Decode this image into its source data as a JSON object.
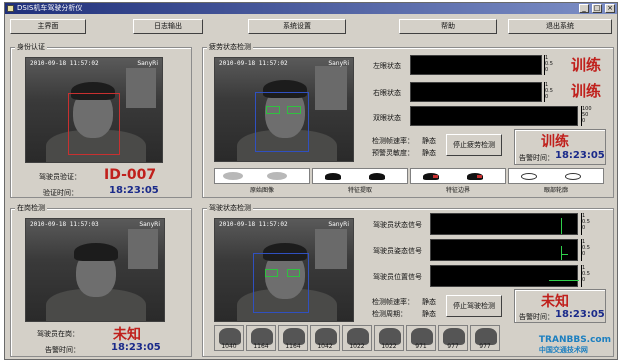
{
  "window": {
    "title": "DSIS机车驾驶分析仪",
    "controls": [
      "_",
      "□",
      "×"
    ]
  },
  "menu": [
    "主界面",
    "日志输出",
    "系统设置",
    "帮助",
    "退出系统"
  ],
  "identity": {
    "legend": "身份认证",
    "stamp": "2010-09-18 11:57:02",
    "stamp_right": "SanyRi",
    "driver_label": "驾驶员验证：",
    "driver_value": "ID-007",
    "time_label": "验证时间：",
    "time_value": "18:23:05"
  },
  "fatigue": {
    "legend": "疲劳状态检测",
    "stamp": "2010-09-18 11:57:02",
    "stamp_right": "SanyRi",
    "left_eye_label": "左眼状态",
    "right_eye_label": "右眼状态",
    "both_eye_label": "双眼状态",
    "left_eye_status": "训练",
    "right_eye_status": "训练",
    "scale_small": [
      "1",
      "0.5",
      "0"
    ],
    "scale_large": [
      "100",
      "50",
      "0"
    ],
    "detect_rate_label": "检测帧速率：",
    "detect_rate_value": "静态",
    "warn_sens_label": "预警灵敏度：",
    "warn_sens_value": "静态",
    "stop_button": "停止疲劳检测",
    "warn_status": "训练",
    "warn_time_label": "告警时间：",
    "warn_time_value": "18:23:05",
    "features": [
      "原始图像",
      "特征提取",
      "特征边界",
      "眼部轮廓"
    ]
  },
  "presence": {
    "legend": "在岗检测",
    "stamp": "2010-09-18 11:57:03",
    "stamp_right": "SanyRi",
    "driver_label": "驾驶员在岗：",
    "driver_value": "未知",
    "time_label": "告警时间：",
    "time_value": "18:23:05"
  },
  "driving": {
    "legend": "驾驶状态检测",
    "stamp": "2010-09-18 11:57:02",
    "stamp_right": "SanyRi",
    "signals": [
      "驾驶员状态信号",
      "驾驶员姿态信号",
      "驾驶员位置信号"
    ],
    "scale_small": [
      "1",
      "0.5",
      "0"
    ],
    "detect_rate_label": "检测帧速率：",
    "detect_rate_value": "静态",
    "detect_period_label": "检测周期：",
    "detect_period_value": "静态",
    "stop_button": "停止驾驶检测",
    "warn_status": "未知",
    "warn_time_label": "告警时间：",
    "warn_time_value": "18:23:05",
    "thumbs": [
      "1040",
      "1164",
      "1164",
      "1042",
      "1022",
      "1022",
      "971",
      "977",
      "977"
    ]
  },
  "watermark": {
    "line1": "TRANBBS.com",
    "line2": "中国交通技术网"
  },
  "colors": {
    "status_red": "#c0201c",
    "time_blue": "#1a2a8a",
    "face_box_red": "#c83030",
    "face_box_blue": "#3050c0",
    "eye_box_green": "#30c040"
  }
}
